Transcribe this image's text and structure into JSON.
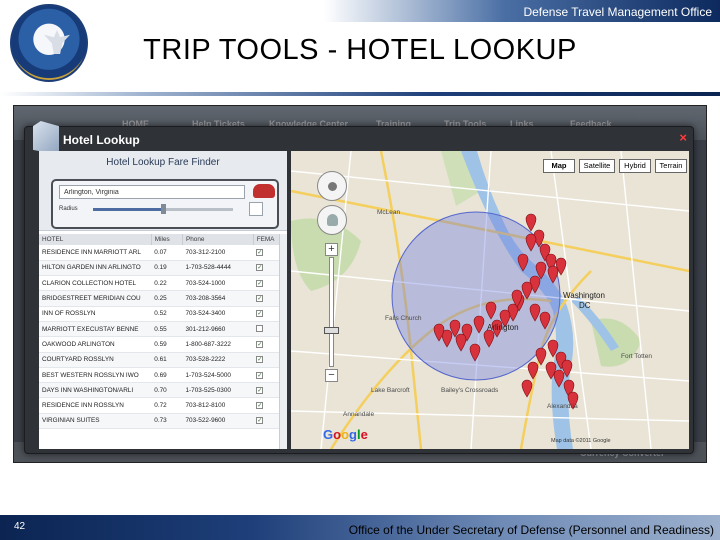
{
  "header": {
    "organization": "Defense Travel Management Office",
    "title": "TRIP TOOLS - HOTEL LOOKUP"
  },
  "background_nav": [
    "HOME",
    "Help Tickets",
    "Knowledge Center",
    "Training",
    "Trip Tools",
    "Links",
    "Feedback"
  ],
  "background_footer": "Currency Converter",
  "window": {
    "title": "Hotel Lookup",
    "close_glyph": "×"
  },
  "finder": {
    "title": "Hotel Lookup Fare Finder",
    "location_value": "Arlington, Virginia",
    "radius_label": "Radius",
    "radius_fraction": 0.5
  },
  "table": {
    "columns": [
      "HOTEL",
      "Miles",
      "Phone",
      "FEMA"
    ],
    "rows": [
      {
        "hotel": "RESIDENCE INN MARRIOTT ARL",
        "miles": "0.07",
        "phone": "703-312-2100",
        "fema": true
      },
      {
        "hotel": "HILTON GARDEN INN ARLINGTO",
        "miles": "0.19",
        "phone": "1-703-528-4444",
        "fema": true
      },
      {
        "hotel": "CLARION COLLECTION HOTEL",
        "miles": "0.22",
        "phone": "703-524-1000",
        "fema": true
      },
      {
        "hotel": "BRIDGESTREET MERIDIAN COU",
        "miles": "0.25",
        "phone": "703-208-3564",
        "fema": true
      },
      {
        "hotel": "INN OF ROSSLYN",
        "miles": "0.52",
        "phone": "703-524-3400",
        "fema": true
      },
      {
        "hotel": "MARRIOTT EXECUSTAY BENNE",
        "miles": "0.55",
        "phone": "301-212-9660",
        "fema": false
      },
      {
        "hotel": "OAKWOOD ARLINGTON",
        "miles": "0.59",
        "phone": "1-800-687-3222",
        "fema": true
      },
      {
        "hotel": "COURTYARD ROSSLYN",
        "miles": "0.61",
        "phone": "703-528-2222",
        "fema": true
      },
      {
        "hotel": "BEST WESTERN ROSSLYN IWO",
        "miles": "0.69",
        "phone": "1-703-524-5000",
        "fema": true
      },
      {
        "hotel": "DAYS INN WASHINGTON/ARLI",
        "miles": "0.70",
        "phone": "1-703-525-0300",
        "fema": true
      },
      {
        "hotel": "RESIDENCE INN ROSSLYN",
        "miles": "0.72",
        "phone": "703-812-8100",
        "fema": true
      },
      {
        "hotel": "VIRGINIAN SUITES",
        "miles": "0.73",
        "phone": "703-522-9600",
        "fema": true
      }
    ]
  },
  "map": {
    "types": [
      "Map",
      "Satellite",
      "Hybrid",
      "Terrain"
    ],
    "active_type": "Map",
    "labels": [
      "Arlington",
      "Washington",
      "DC",
      "McLean",
      "Falls Church",
      "Annandale",
      "Alexandria",
      "Bailey's Crossroads",
      "Lake Barcroft",
      "Fort Totten"
    ],
    "attribution": "Map data ©2011 Google",
    "logo": [
      "G",
      "o",
      "o",
      "g",
      "l",
      "e"
    ],
    "zoom_plus": "+",
    "zoom_minus": "−"
  },
  "footer": {
    "page_number": "42",
    "office": "Office of the Under Secretary of Defense (Personnel and Readiness)"
  },
  "colors": {
    "navy": "#0b2452",
    "marker": "#d8323c",
    "radius_circle": "#6a78e0"
  }
}
